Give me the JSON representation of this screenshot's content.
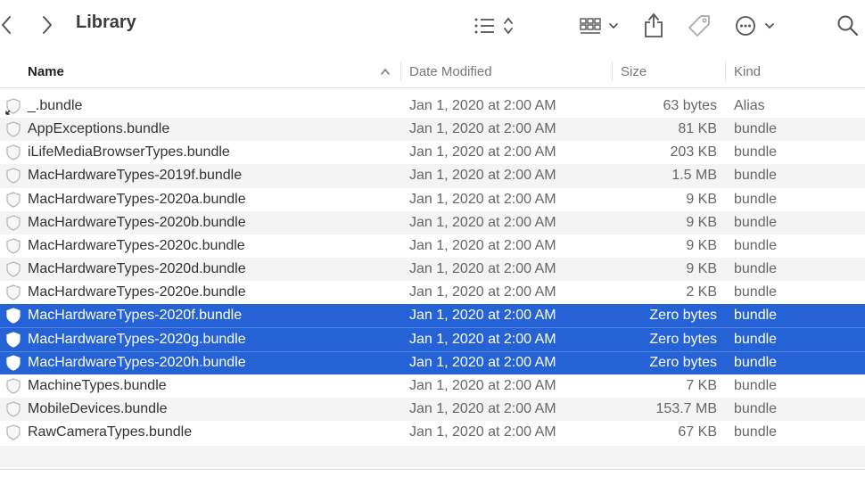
{
  "toolbar": {
    "back_icon": "chevron-left-icon",
    "forward_icon": "chevron-right-icon",
    "title": "Library",
    "view_icon": "list-view-icon",
    "group_icon": "grid-view-icon",
    "share_icon": "share-icon",
    "tag_icon": "tag-icon",
    "action_icon": "ellipsis-circle-icon",
    "search_icon": "search-icon"
  },
  "columns": {
    "name": "Name",
    "date": "Date Modified",
    "size": "Size",
    "kind": "Kind"
  },
  "colors": {
    "selection": "#2462d6",
    "alt_row": "#f4f4f4"
  },
  "files": [
    {
      "name": "_.bundle",
      "date": "Jan 1, 2020 at 2:00 AM",
      "size": "63 bytes",
      "kind": "Alias",
      "selected": false,
      "alias": true
    },
    {
      "name": "AppExceptions.bundle",
      "date": "Jan 1, 2020 at 2:00 AM",
      "size": "81 KB",
      "kind": "bundle",
      "selected": false
    },
    {
      "name": "iLifeMediaBrowserTypes.bundle",
      "date": "Jan 1, 2020 at 2:00 AM",
      "size": "203 KB",
      "kind": "bundle",
      "selected": false
    },
    {
      "name": "MacHardwareTypes-2019f.bundle",
      "date": "Jan 1, 2020 at 2:00 AM",
      "size": "1.5 MB",
      "kind": "bundle",
      "selected": false
    },
    {
      "name": "MacHardwareTypes-2020a.bundle",
      "date": "Jan 1, 2020 at 2:00 AM",
      "size": "9 KB",
      "kind": "bundle",
      "selected": false
    },
    {
      "name": "MacHardwareTypes-2020b.bundle",
      "date": "Jan 1, 2020 at 2:00 AM",
      "size": "9 KB",
      "kind": "bundle",
      "selected": false
    },
    {
      "name": "MacHardwareTypes-2020c.bundle",
      "date": "Jan 1, 2020 at 2:00 AM",
      "size": "9 KB",
      "kind": "bundle",
      "selected": false
    },
    {
      "name": "MacHardwareTypes-2020d.bundle",
      "date": "Jan 1, 2020 at 2:00 AM",
      "size": "9 KB",
      "kind": "bundle",
      "selected": false
    },
    {
      "name": "MacHardwareTypes-2020e.bundle",
      "date": "Jan 1, 2020 at 2:00 AM",
      "size": "2 KB",
      "kind": "bundle",
      "selected": false
    },
    {
      "name": "MacHardwareTypes-2020f.bundle",
      "date": "Jan 1, 2020 at 2:00 AM",
      "size": "Zero bytes",
      "kind": "bundle",
      "selected": true
    },
    {
      "name": "MacHardwareTypes-2020g.bundle",
      "date": "Jan 1, 2020 at 2:00 AM",
      "size": "Zero bytes",
      "kind": "bundle",
      "selected": true
    },
    {
      "name": "MacHardwareTypes-2020h.bundle",
      "date": "Jan 1, 2020 at 2:00 AM",
      "size": "Zero bytes",
      "kind": "bundle",
      "selected": true
    },
    {
      "name": "MachineTypes.bundle",
      "date": "Jan 1, 2020 at 2:00 AM",
      "size": "7 KB",
      "kind": "bundle",
      "selected": false
    },
    {
      "name": "MobileDevices.bundle",
      "date": "Jan 1, 2020 at 2:00 AM",
      "size": "153.7 MB",
      "kind": "bundle",
      "selected": false
    },
    {
      "name": "RawCameraTypes.bundle",
      "date": "Jan 1, 2020 at 2:00 AM",
      "size": "67 KB",
      "kind": "bundle",
      "selected": false
    }
  ]
}
